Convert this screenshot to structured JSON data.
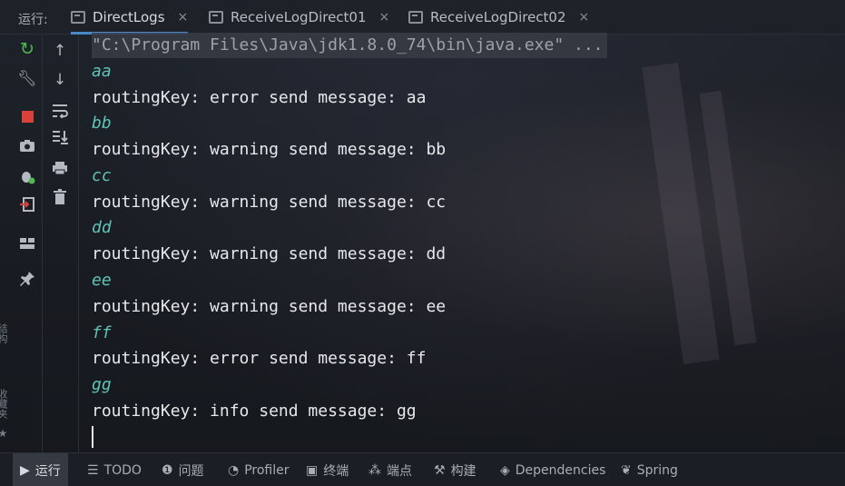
{
  "toolwindow": {
    "title": "运行:"
  },
  "tabs": [
    {
      "label": "DirectLogs",
      "close": "×",
      "active": true
    },
    {
      "label": "ReceiveLogDirect01",
      "close": "×",
      "active": false
    },
    {
      "label": "ReceiveLogDirect02",
      "close": "×",
      "active": false
    }
  ],
  "left_sidebar": {
    "icons": [
      "rerun-icon",
      "wrench-icon",
      "stop-icon",
      "camera-icon",
      "debug-icon",
      "exit-icon",
      "layout-icon",
      "pin-icon"
    ],
    "vertical_labels": [
      "结构",
      "收藏夹"
    ]
  },
  "console_toolbar": {
    "icons": [
      "arrow-up-icon",
      "arrow-down-icon",
      "soft-wrap-icon",
      "scroll-to-end-icon",
      "print-icon",
      "trash-icon"
    ]
  },
  "console": {
    "command": "\"C:\\Program Files\\Java\\jdk1.8.0_74\\bin\\java.exe\" ...",
    "lines": [
      {
        "type": "input",
        "text": "aa"
      },
      {
        "type": "output",
        "text": "routingKey: error send message: aa"
      },
      {
        "type": "input",
        "text": "bb"
      },
      {
        "type": "output",
        "text": "routingKey: warning send message: bb"
      },
      {
        "type": "input",
        "text": "cc"
      },
      {
        "type": "output",
        "text": "routingKey: warning send message: cc"
      },
      {
        "type": "input",
        "text": "dd"
      },
      {
        "type": "output",
        "text": "routingKey: warning send message: dd"
      },
      {
        "type": "input",
        "text": "ee"
      },
      {
        "type": "output",
        "text": "routingKey: warning send message: ee"
      },
      {
        "type": "input",
        "text": "ff"
      },
      {
        "type": "output",
        "text": "routingKey: error send message: ff"
      },
      {
        "type": "input",
        "text": "gg"
      },
      {
        "type": "output",
        "text": "routingKey: info send message: gg"
      }
    ]
  },
  "bottom_toolbar": [
    {
      "label": "运行",
      "icon": "run-icon",
      "active": true
    },
    {
      "label": "TODO",
      "icon": "todo-icon",
      "active": false
    },
    {
      "label": "问题",
      "icon": "problems-icon",
      "active": false
    },
    {
      "label": "Profiler",
      "icon": "profiler-icon",
      "active": false
    },
    {
      "label": "终端",
      "icon": "terminal-icon",
      "active": false
    },
    {
      "label": "端点",
      "icon": "endpoints-icon",
      "active": false
    },
    {
      "label": "构建",
      "icon": "build-icon",
      "active": false
    },
    {
      "label": "Dependencies",
      "icon": "dependencies-icon",
      "active": false
    },
    {
      "label": "Spring",
      "icon": "spring-icon",
      "active": false
    }
  ],
  "colors": {
    "input_text": "#5fc4b6",
    "output_text": "#e6e8ec",
    "command_text": "#9da1a9",
    "active_tab_underline": "#4a88c7",
    "rerun_icon": "#4fb84f",
    "stop_icon": "#d9423a"
  }
}
